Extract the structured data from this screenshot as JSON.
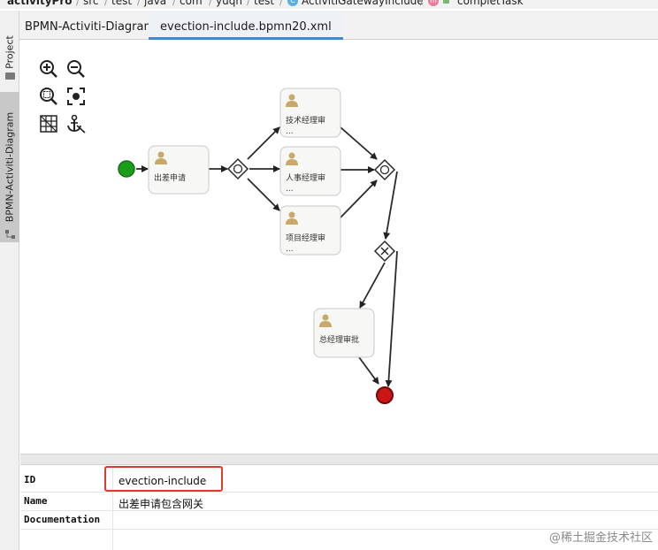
{
  "breadcrumb": {
    "items": [
      "activityPro",
      "src",
      "test",
      "java",
      "com",
      "yuqn",
      "test",
      "ActivitiGatewayInclude",
      "completTask"
    ],
    "class_badge": "C",
    "method_badge": "m"
  },
  "left_strip": {
    "project_label": "Project",
    "bpmn_label": "BPMN-Activiti-Diagram"
  },
  "tabs": {
    "diagram_tab": "BPMN-Activiti-Diagram",
    "file_tab": "evection-include.bpmn20.xml"
  },
  "diagram": {
    "tasks": {
      "apply": "出差申请",
      "tech": "技术经理审",
      "hr": "人事经理审",
      "project": "项目经理审",
      "gm": "总经理审批"
    },
    "ellipsis": "...",
    "colors": {
      "start_event": "#1a9e1a",
      "end_event": "#cc1515",
      "task_fill": "#f7f7f5",
      "task_border": "#c9c9c9",
      "user_icon": "#c9a96a",
      "highlight": "#e03a2f"
    }
  },
  "properties": {
    "id_label": "ID",
    "id_value": "evection-include",
    "name_label": "Name",
    "name_value": "出差申请包含网关",
    "doc_label": "Documentation",
    "doc_value": ""
  },
  "watermark": "@稀土掘金技术社区"
}
